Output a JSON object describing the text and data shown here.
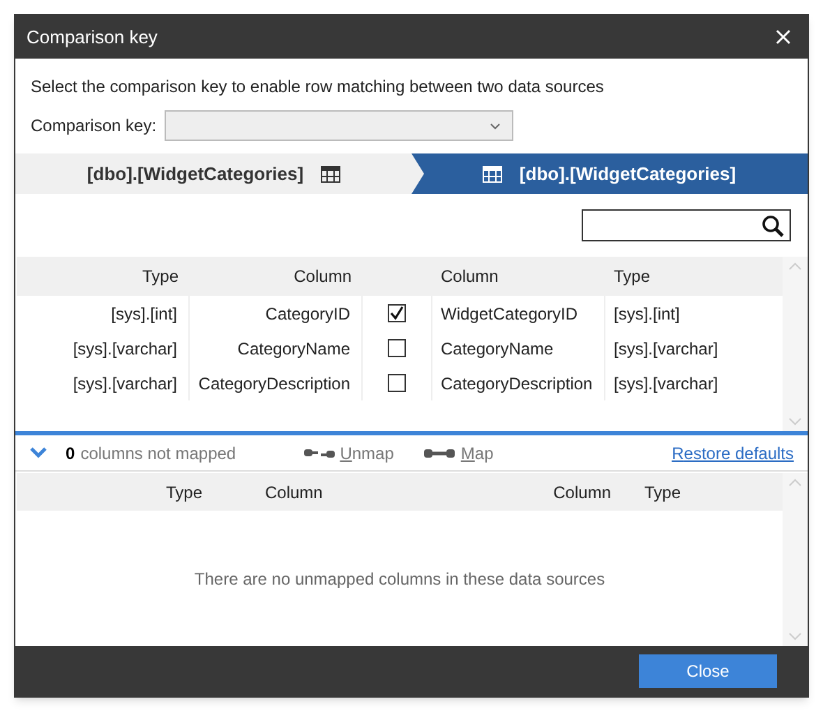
{
  "window": {
    "title": "Comparison key"
  },
  "description": "Select the comparison key to enable row matching between two data sources",
  "comparison_key": {
    "label": "Comparison key:"
  },
  "sources": [
    {
      "label": "[dbo].[WidgetCategories]",
      "selected": false
    },
    {
      "label": "[dbo].[WidgetCategories]",
      "selected": true
    }
  ],
  "mapped_table": {
    "columns": [
      "Type",
      "Column",
      "Column",
      "Type"
    ],
    "rows": [
      {
        "left_type": "[sys].[int]",
        "left_column": "CategoryID",
        "checked": true,
        "right_column": "WidgetCategoryID",
        "right_type": "[sys].[int]"
      },
      {
        "left_type": "[sys].[varchar]",
        "left_column": "CategoryName",
        "checked": false,
        "right_column": "CategoryName",
        "right_type": "[sys].[varchar]"
      },
      {
        "left_type": "[sys].[varchar]",
        "left_column": "CategoryDescription",
        "checked": false,
        "right_column": "CategoryDescription",
        "right_type": "[sys].[varchar]"
      }
    ]
  },
  "mapping_bar": {
    "expanded": true,
    "count": "0",
    "count_label": "columns not mapped",
    "unmap": "Unmap",
    "map": "Map",
    "restore": "Restore defaults"
  },
  "unmapped_table": {
    "columns": [
      "Type",
      "Column",
      "Column",
      "Type"
    ],
    "empty_message": "There are no unmapped columns in these data sources"
  },
  "buttons": [
    "Close"
  ]
}
